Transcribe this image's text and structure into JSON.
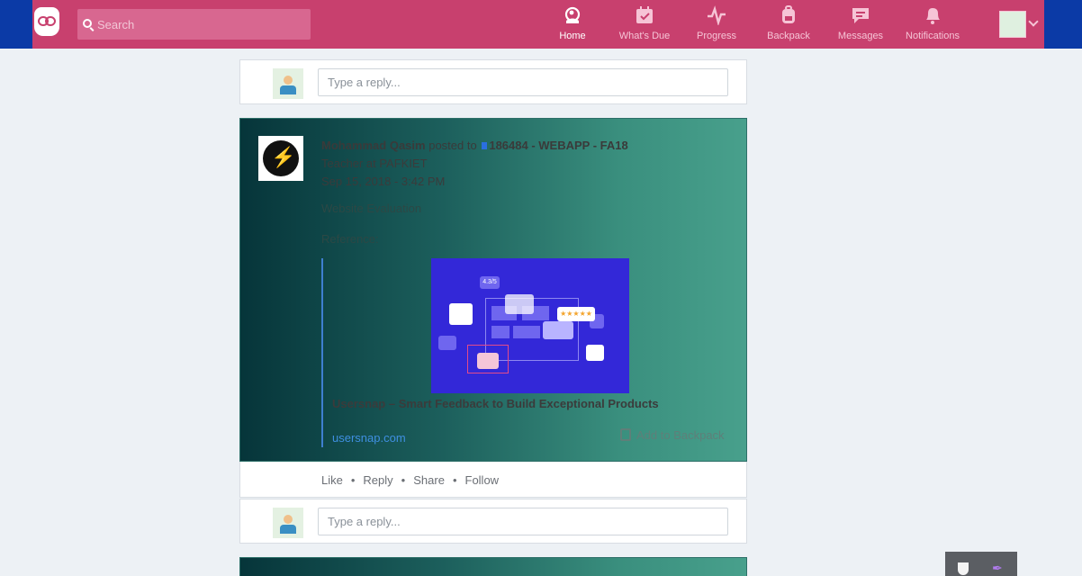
{
  "topbar": {
    "search_placeholder": "Search",
    "nav": [
      {
        "label": "Home",
        "icon": "home-icon",
        "active": true
      },
      {
        "label": "What's Due",
        "icon": "calendar-icon",
        "active": false
      },
      {
        "label": "Progress",
        "icon": "pulse-icon",
        "active": false
      },
      {
        "label": "Backpack",
        "icon": "backpack-icon",
        "active": false
      },
      {
        "label": "Messages",
        "icon": "chat-icon",
        "active": false
      },
      {
        "label": "Notifications",
        "icon": "bell-icon",
        "active": false
      }
    ],
    "colors": {
      "bar": "#c8406e",
      "edge": "#0b3aa6"
    }
  },
  "reply_placeholder": "Type a reply...",
  "post": {
    "author": "Mohammad Qasim",
    "posted_to": "posted to",
    "group": "186484 - WEBAPP - FA18",
    "role": "Teacher at PAFKIET",
    "date": "Sep 15, 2018 - 3:42 PM",
    "body_line1": "Website Evaluation",
    "body_line2": "Reference:",
    "preview": {
      "title": "Usersnap – Smart Feedback to Build Exceptional Products",
      "domain": "usersnap.com",
      "rating_label": "★★★★★",
      "badge": "4.3/5"
    },
    "add_to_backpack": "Add to Backpack",
    "actions": [
      "Like",
      "Reply",
      "Share",
      "Follow"
    ]
  }
}
